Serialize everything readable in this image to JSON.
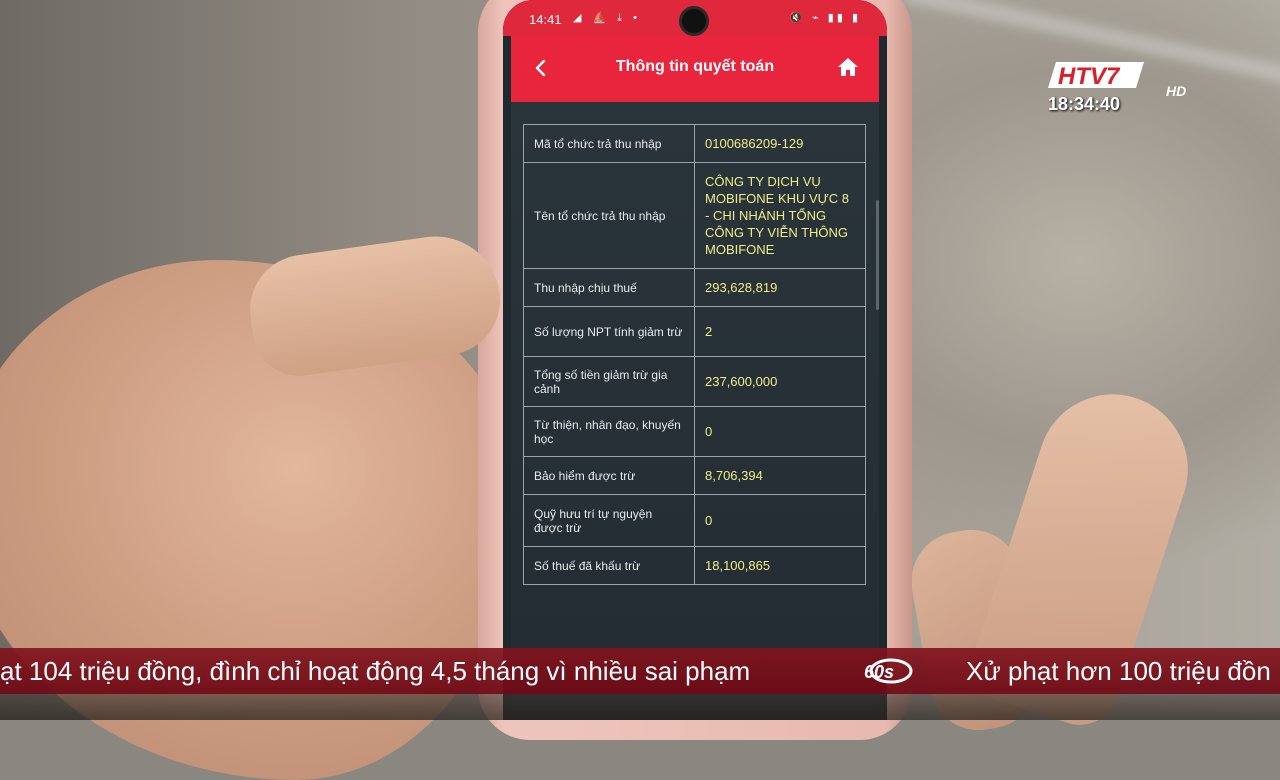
{
  "phone": {
    "status_time": "14:41",
    "status_icons_left": "◢ ⛵ ⤓ •",
    "status_icons_right": "🔇 ⌁ ▮▮ ▮",
    "header": {
      "title": "Thông tin quyết toán",
      "back_icon": "chevron-left-icon",
      "home_icon": "home-icon"
    },
    "rows": [
      {
        "label": "Mã tổ chức trả thu nhập",
        "value": "0100686209-129"
      },
      {
        "label": "Tên tổ chức trả thu nhập",
        "value": "CÔNG TY DỊCH VỤ MOBIFONE KHU VỰC 8 - CHI NHÁNH TỔNG CÔNG TY VIỄN THÔNG MOBIFONE"
      },
      {
        "label": "Thu nhập chịu thuế",
        "value": "293,628,819"
      },
      {
        "label": "Số lượng NPT tính giảm trừ",
        "value": "2"
      },
      {
        "label": "Tổng số tiền giảm trừ gia cảnh",
        "value": "237,600,000"
      },
      {
        "label": "Từ thiện, nhân đạo, khuyến học",
        "value": "0"
      },
      {
        "label": "Bảo hiểm được trừ",
        "value": "8,706,394"
      },
      {
        "label": "Quỹ hưu trí tự nguyện được trừ",
        "value": "0"
      },
      {
        "label": "Số thuế đã khấu trừ",
        "value": "18,100,865"
      }
    ],
    "colors": {
      "header": "#e8253c",
      "value_text": "#f0ee8a"
    }
  },
  "broadcast": {
    "channel_logo": "HTV7",
    "logo_suffix": "HD",
    "clock": "18:34:40",
    "ticker_1": "ạt 104 triệu đồng, đình chỉ hoạt động 4,5 tháng vì nhiều sai phạm",
    "ticker_logo": "60s",
    "ticker_2": "Xử phạt hơn 100 triệu đồn"
  }
}
